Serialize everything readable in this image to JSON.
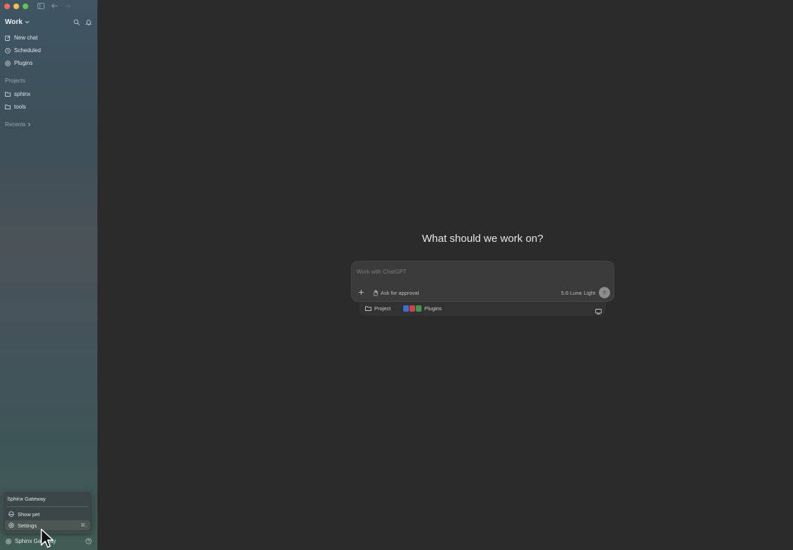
{
  "sidebar": {
    "workspace": "Work",
    "nav": [
      {
        "label": "New chat",
        "icon": "edit-icon"
      },
      {
        "label": "Scheduled",
        "icon": "clock-icon"
      },
      {
        "label": "Plugins",
        "icon": "plugin-icon"
      }
    ],
    "projects_label": "Projects",
    "projects": [
      {
        "label": "sphinx",
        "icon": "folder-icon"
      },
      {
        "label": "tools",
        "icon": "folder-icon"
      }
    ],
    "recents_label": "Recents"
  },
  "popup": {
    "title": "Sphinx Gateway",
    "items": [
      {
        "label": "Show pet",
        "icon": "pet-icon"
      },
      {
        "label": "Settings",
        "icon": "gear-icon",
        "shortcut": "⌘,"
      }
    ]
  },
  "footer": {
    "account": "Sphinx Gateway"
  },
  "main": {
    "heading": "What should we work on?",
    "composer": {
      "placeholder": "Work with ChatGPT",
      "approval": "Ask for approval",
      "model": "5.6 Luna",
      "mode": "Light"
    },
    "subbar": {
      "project": "Project",
      "plugins": "Plugins"
    }
  },
  "colors": {
    "background": "#2b2b2b",
    "composer": "#3b3b3b",
    "sidebar_top": "#3f5563",
    "sidebar_bottom": "#415c55"
  }
}
